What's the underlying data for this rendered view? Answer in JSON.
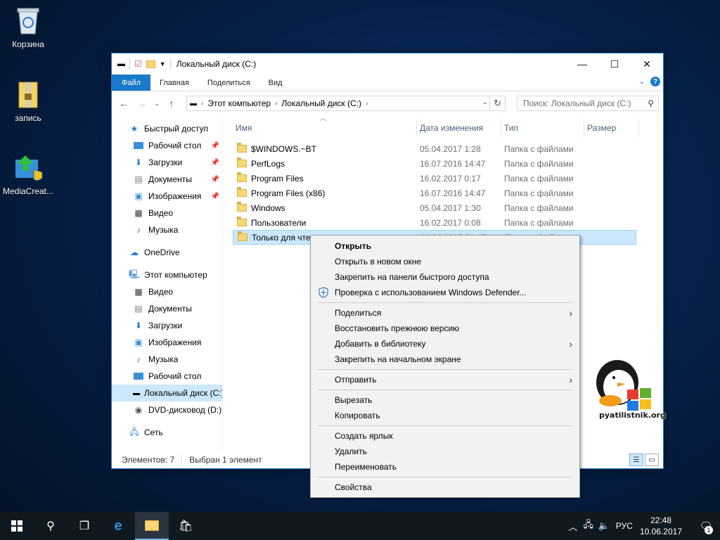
{
  "desktop": {
    "icons": [
      {
        "label": "Корзина",
        "icon": "recycle-bin-icon"
      },
      {
        "label": "запись",
        "icon": "archive-file-icon"
      },
      {
        "label": "MediaCreat...",
        "icon": "media-creation-tool-icon"
      }
    ]
  },
  "window": {
    "title": "Локальный диск (C:)",
    "controls": {
      "minimize": "—",
      "maximize": "☐",
      "close": "✕"
    },
    "ribbon_tabs": [
      "Файл",
      "Главная",
      "Поделиться",
      "Вид"
    ],
    "address": {
      "crumbs": [
        "Этот компьютер",
        "Локальный диск (C:)"
      ],
      "search_placeholder": "Поиск: Локальный диск (C:)"
    },
    "nav": {
      "quick_access": "Быстрый доступ",
      "quick_items": [
        "Рабочий стол",
        "Загрузки",
        "Документы",
        "Изображения",
        "Видео",
        "Музыка"
      ],
      "onedrive": "OneDrive",
      "this_pc": "Этот компьютер",
      "pc_items": [
        "Видео",
        "Документы",
        "Загрузки",
        "Изображения",
        "Музыка",
        "Рабочий стол",
        "Локальный диск (C:)",
        "DVD-дисковод (D:)"
      ],
      "network": "Сеть"
    },
    "columns": {
      "name": "Имя",
      "date": "Дата изменения",
      "type": "Тип",
      "size": "Размер"
    },
    "files": [
      {
        "name": "$WINDOWS.~BT",
        "date": "05.04.2017 1:28",
        "type": "Папка с файлами"
      },
      {
        "name": "PerfLogs",
        "date": "16.07.2016 14:47",
        "type": "Папка с файлами"
      },
      {
        "name": "Program Files",
        "date": "16.02.2017 0:17",
        "type": "Папка с файлами"
      },
      {
        "name": "Program Files (x86)",
        "date": "16.07.2016 14:47",
        "type": "Папка с файлами"
      },
      {
        "name": "Windows",
        "date": "05.04.2017 1:30",
        "type": "Папка с файлами"
      },
      {
        "name": "Пользователи",
        "date": "16.02.2017 0:08",
        "type": "Папка с файлами"
      },
      {
        "name": "Только для чтения",
        "date": "10.06.2017 22:47",
        "type": "Папка с файлами"
      }
    ],
    "status": {
      "count": "Элементов: 7",
      "selected": "Выбран 1 элемент"
    }
  },
  "context_menu": {
    "groups": [
      [
        {
          "label": "Открыть",
          "bold": true
        },
        {
          "label": "Открыть в новом окне"
        },
        {
          "label": "Закрепить на панели быстрого доступа"
        },
        {
          "label": "Проверка с использованием Windows Defender...",
          "icon": "windows-defender-icon"
        }
      ],
      [
        {
          "label": "Поделиться",
          "submenu": true
        },
        {
          "label": "Восстановить прежнюю версию"
        },
        {
          "label": "Добавить в библиотеку",
          "submenu": true
        },
        {
          "label": "Закрепить на начальном экране"
        }
      ],
      [
        {
          "label": "Отправить",
          "submenu": true
        }
      ],
      [
        {
          "label": "Вырезать"
        },
        {
          "label": "Копировать"
        }
      ],
      [
        {
          "label": "Создать ярлык"
        },
        {
          "label": "Удалить"
        },
        {
          "label": "Переименовать"
        }
      ],
      [
        {
          "label": "Свойства"
        }
      ]
    ]
  },
  "watermark": {
    "text": "pyatilistnik.org"
  },
  "taskbar": {
    "buttons": [
      "start-icon",
      "search-icon",
      "task-view-icon",
      "edge-icon",
      "file-explorer-icon",
      "store-icon"
    ],
    "language": "РУС",
    "time": "22:48",
    "date": "10.06.2017",
    "notification_count": "1"
  },
  "colors": {
    "accent": "#1979ca",
    "selection": "#cce8ff",
    "desktop": "#06214a"
  }
}
